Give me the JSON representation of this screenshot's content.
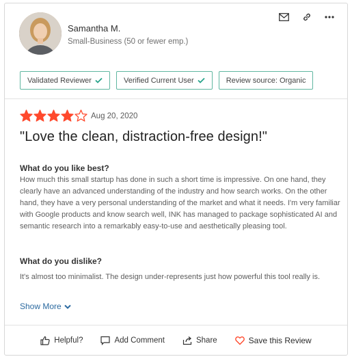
{
  "reviewer": {
    "name": "Samantha M.",
    "segment": "Small-Business (50 or fewer emp.)"
  },
  "icons": {
    "email": "email-icon",
    "link": "link-icon",
    "more": "more-options-icon"
  },
  "badges": [
    {
      "label": "Validated Reviewer",
      "checked": true
    },
    {
      "label": "Verified Current User",
      "checked": true
    },
    {
      "label": "Review source: Organic",
      "checked": false
    }
  ],
  "review": {
    "rating": 4,
    "rating_max": 5,
    "date": "Aug 20, 2020",
    "title": "\"Love the clean, distraction-free design!\"",
    "like_heading": "What do you like best?",
    "like_text": "How much this small startup has done in such a short time is impressive. On one hand, they clearly have an advanced understanding of the industry and how search works. On the other hand, they have a very personal understanding of the market and what it needs. I'm very familiar with Google products and know search well, INK has managed to package sophisticated AI and semantic research into a remarkably easy-to-use and aesthetically pleasing tool.",
    "dislike_heading": "What do you dislike?",
    "dislike_text": "It's almost too minimalist. The design under-represents just how powerful this tool really is.",
    "show_more_label": "Show More"
  },
  "actions": {
    "helpful": "Helpful?",
    "add_comment": "Add Comment",
    "share": "Share",
    "save": "Save this Review"
  },
  "colors": {
    "star": "#ff492c",
    "badge_border": "#5fb6a0",
    "check": "#27a38a",
    "link": "#2c6aa0",
    "heart": "#ff492c"
  }
}
